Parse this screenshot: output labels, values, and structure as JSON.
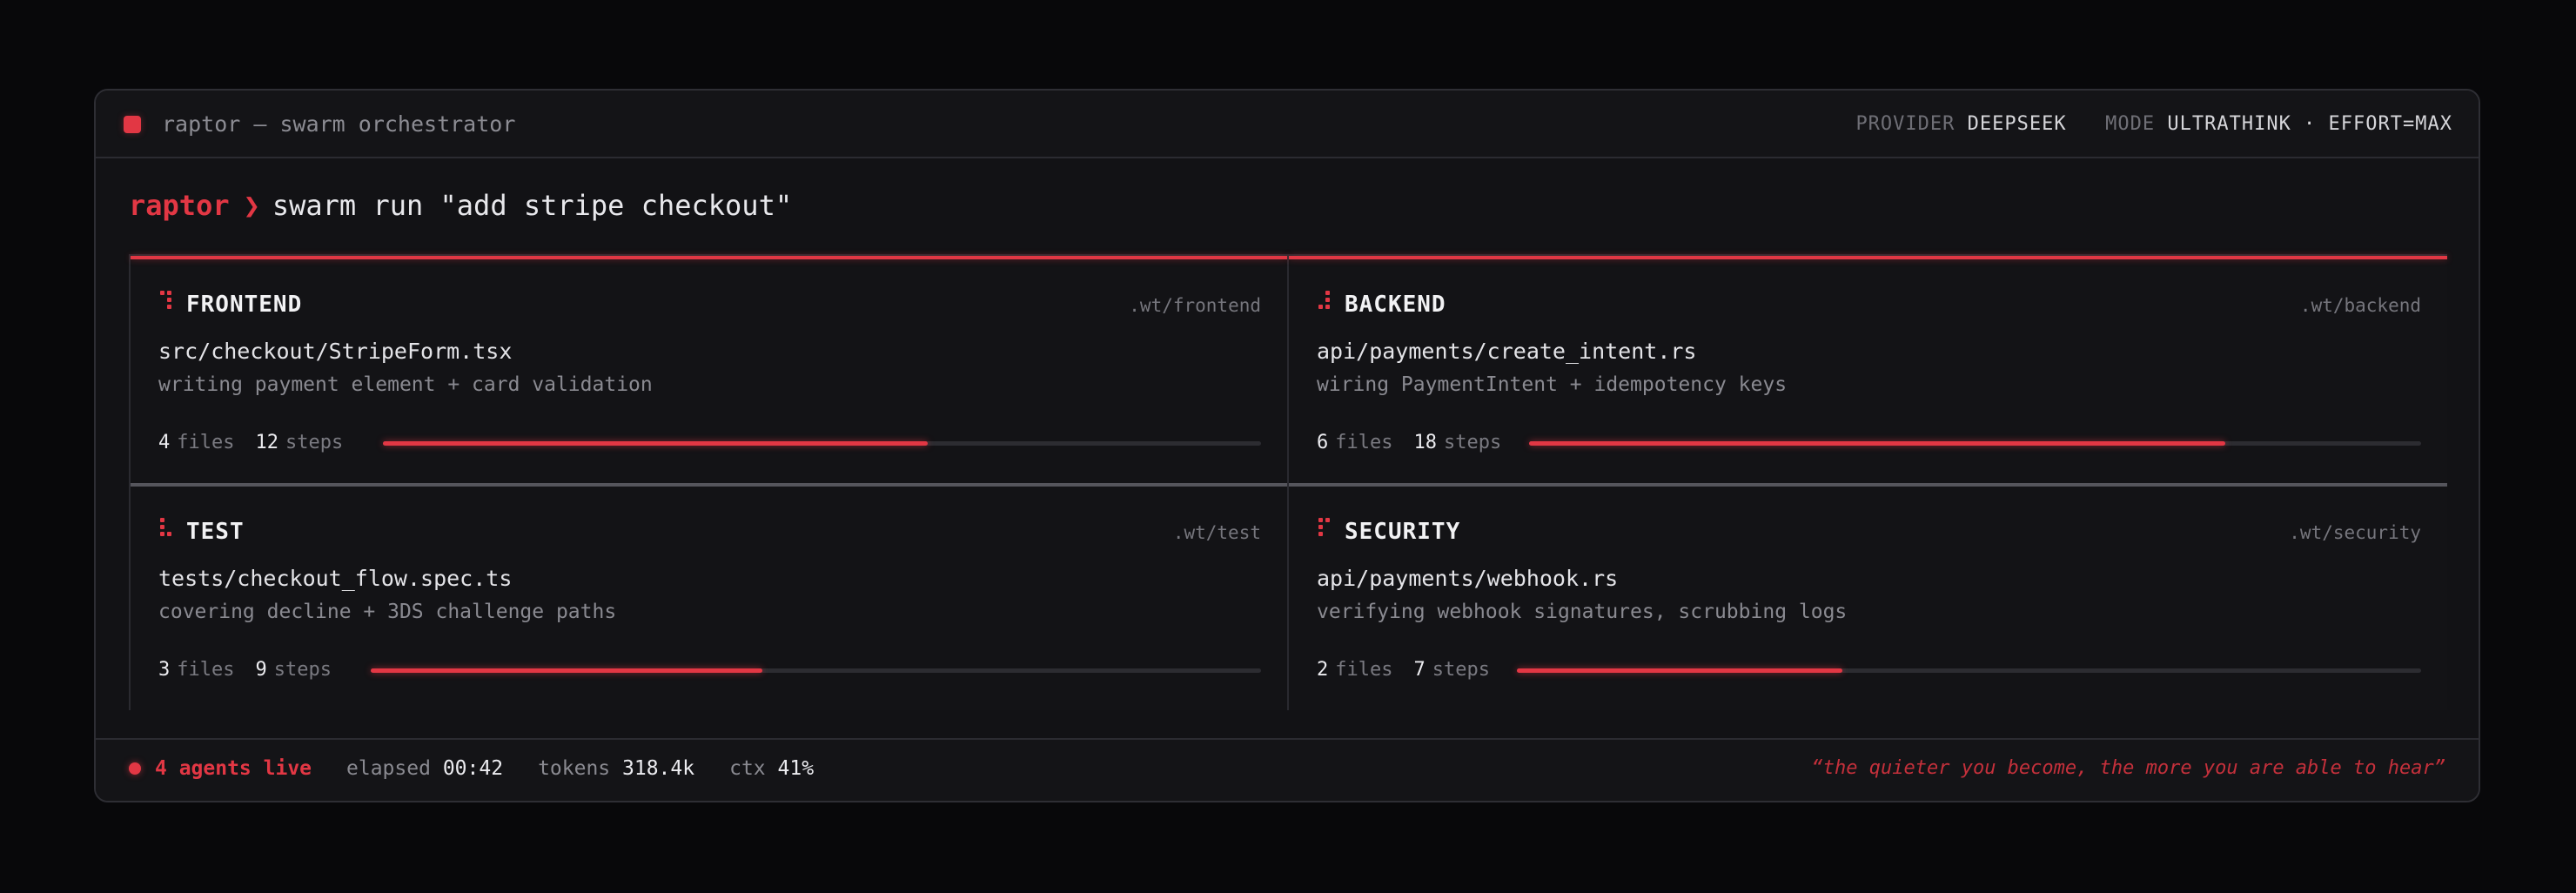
{
  "window": {
    "title": "raptor — swarm orchestrator",
    "meta": {
      "provider_label": "PROVIDER",
      "provider_value": "DEEPSEEK",
      "mode_label": "MODE",
      "mode_value": "ULTRATHINK · EFFORT=MAX"
    }
  },
  "prompt": {
    "host": "raptor",
    "arrow": "❯",
    "command": "swarm run \"add stripe checkout\""
  },
  "agents": [
    {
      "name": "FRONTEND",
      "worktree": ".wt/frontend",
      "file": "src/checkout/StripeForm.tsx",
      "description": "writing payment element + card validation",
      "files": "4",
      "files_label": "files",
      "steps": "12",
      "steps_label": "steps",
      "progress": 0.62,
      "accent": "red"
    },
    {
      "name": "BACKEND",
      "worktree": ".wt/backend",
      "file": "api/payments/create_intent.rs",
      "description": "wiring PaymentIntent + idempotency keys",
      "files": "6",
      "files_label": "files",
      "steps": "18",
      "steps_label": "steps",
      "progress": 0.78,
      "accent": "red"
    },
    {
      "name": "TEST",
      "worktree": ".wt/test",
      "file": "tests/checkout_flow.spec.ts",
      "description": "covering decline + 3DS challenge paths",
      "files": "3",
      "files_label": "files",
      "steps": "9",
      "steps_label": "steps",
      "progress": 0.44,
      "accent": "gray"
    },
    {
      "name": "SECURITY",
      "worktree": ".wt/security",
      "file": "api/payments/webhook.rs",
      "description": "verifying webhook signatures, scrubbing logs",
      "files": "2",
      "files_label": "files",
      "steps": "7",
      "steps_label": "steps",
      "progress": 0.36,
      "accent": "gray"
    }
  ],
  "status": {
    "live": "4 agents live",
    "elapsed_label": "elapsed",
    "elapsed_value": "00:42",
    "tokens_label": "tokens",
    "tokens_value": "318.4k",
    "ctx_label": "ctx",
    "ctx_value": "41%",
    "quote": "“the quieter you become, the more you are able to hear”"
  },
  "colors": {
    "accent": "#e23744",
    "background": "#08080a",
    "panel": "#131316",
    "border": "#2a2a30"
  },
  "icons": [
    "window-status-icon",
    "agent-dots-icon",
    "live-status-dot-icon"
  ]
}
